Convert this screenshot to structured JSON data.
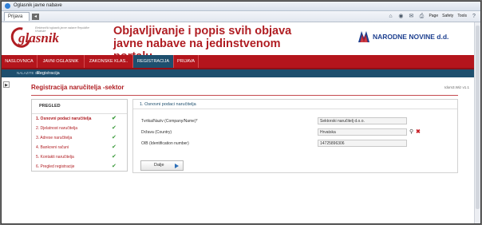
{
  "window": {
    "title": "Oglasnik javne nabave"
  },
  "browser": {
    "tab_label": "Prijava",
    "tools": {
      "page_label": "Page",
      "safety_label": "Safety",
      "tools_label": "Tools"
    }
  },
  "header": {
    "logo_text": "glasnik",
    "logo_tagline": "Elektronički oglasnik javne nabave Republike Hrvatske",
    "headline": "Objavljivanje i popis svih objava javne nabave na jedinstvenom portalu.",
    "partner": "NARODNE NOVINE d.d."
  },
  "nav": {
    "items": [
      {
        "label": "NASLOVNICA"
      },
      {
        "label": "JAVNI OGLASNIK"
      },
      {
        "label": "ZAKONSKE KLAS.."
      },
      {
        "label": "REGISTRACIJA"
      },
      {
        "label": "PRIJAVA"
      }
    ]
  },
  "breadcrumb": {
    "label": "NALAZITE SE:",
    "current": "Registracija"
  },
  "page": {
    "title": "Registracija naručitelja -sektor",
    "version": "Idom3.Wiz v1.1"
  },
  "steps": {
    "header": "PREGLED",
    "items": [
      {
        "label": "1. Osnovni podaci naručitelja"
      },
      {
        "label": "2. Djelatnost naručitelja"
      },
      {
        "label": "3. Adrese naručitelja"
      },
      {
        "label": "4. Bankovni računi"
      },
      {
        "label": "5. Kontakti naručitelja"
      },
      {
        "label": "6. Pregled registracije"
      }
    ]
  },
  "form": {
    "section_title": "1. Osnovni podaci naručitelja",
    "fields": [
      {
        "label": "Tvrtka/Naziv (Company/Name)*",
        "value": "Sektorski naručitelj d.o.o."
      },
      {
        "label": "Država (Country)",
        "value": "Hrvatska"
      },
      {
        "label": "OIB (Identification number)",
        "value": "14725896306"
      }
    ],
    "next_button": "Dalje"
  },
  "colors": {
    "brand_red": "#b01e23",
    "nav_blue": "#1e4f6e",
    "check_green": "#3a9a3a"
  }
}
